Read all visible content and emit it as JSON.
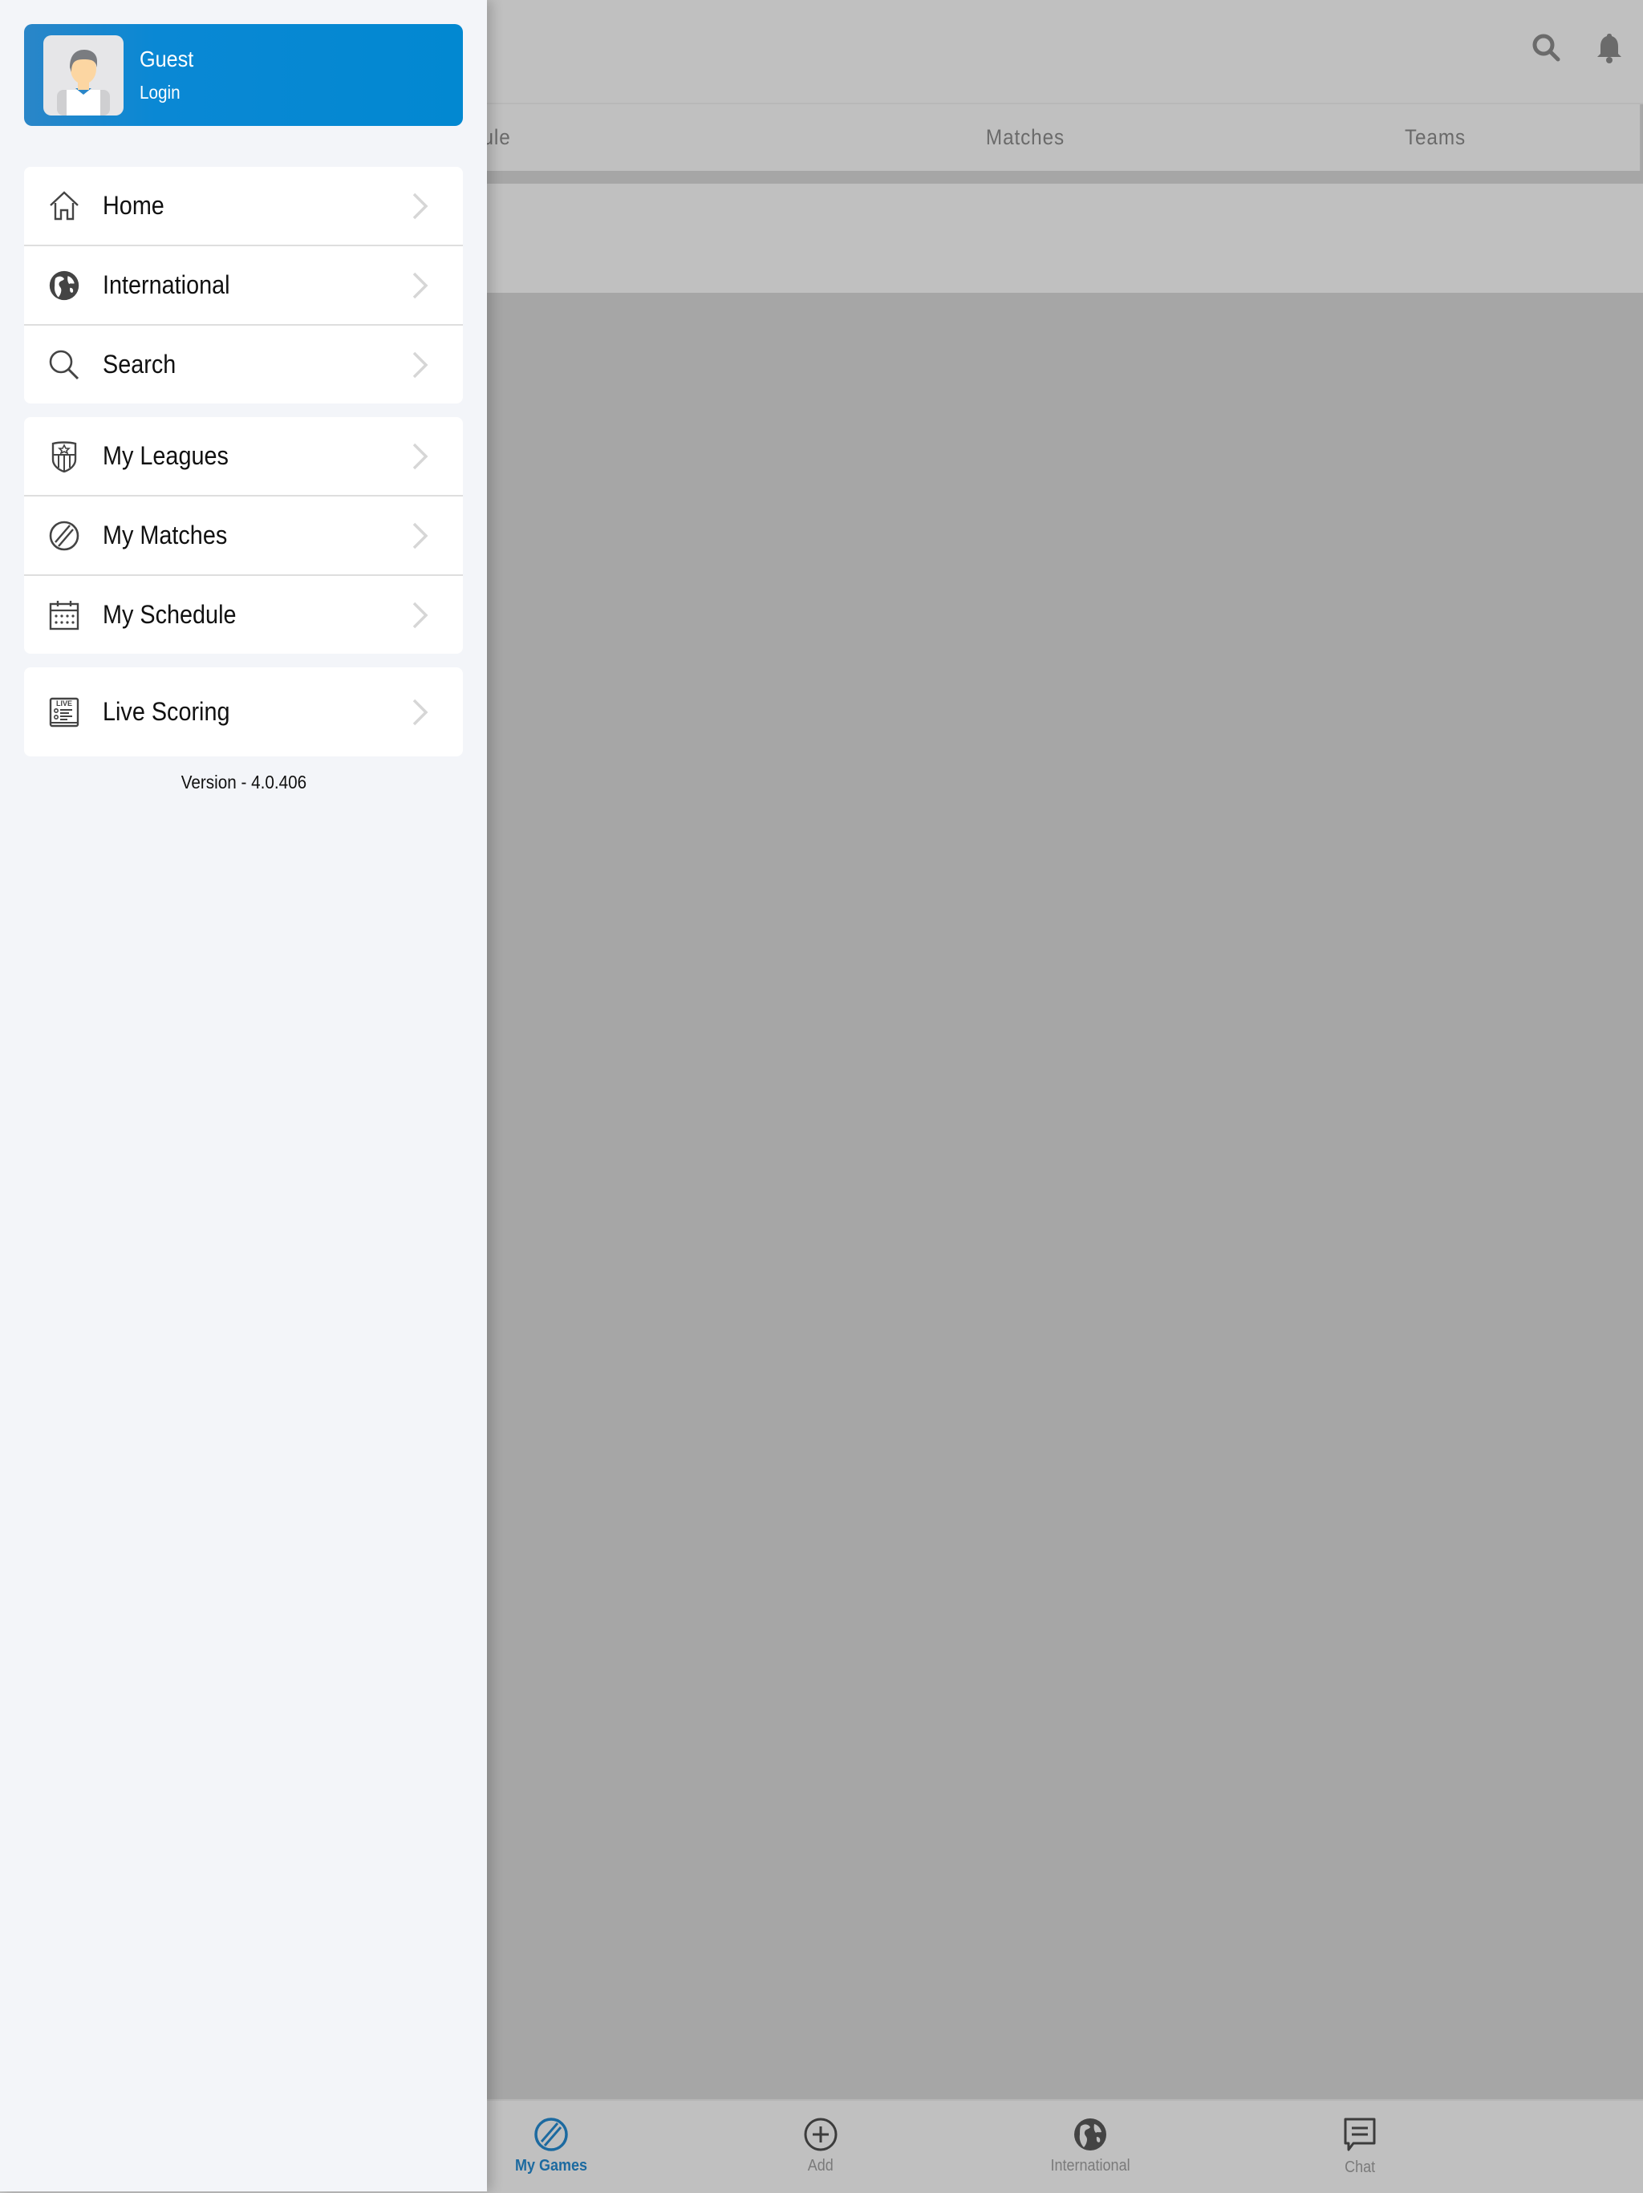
{
  "drawer": {
    "profile": {
      "name": "Guest",
      "action": "Login",
      "avatar_icon": "user-avatar-icon"
    },
    "groups": [
      [
        {
          "label": "Home",
          "icon": "home-icon"
        },
        {
          "label": "International",
          "icon": "globe-icon"
        },
        {
          "label": "Search",
          "icon": "search-icon"
        }
      ],
      [
        {
          "label": "My Leagues",
          "icon": "league-shield-icon"
        },
        {
          "label": "My Matches",
          "icon": "cricket-ball-icon"
        },
        {
          "label": "My Schedule",
          "icon": "calendar-icon"
        }
      ],
      [
        {
          "label": "Live Scoring",
          "icon": "live-scoring-icon"
        }
      ]
    ],
    "version": "Version - 4.0.406"
  },
  "app": {
    "header_icons": [
      "search-icon",
      "bell-icon"
    ],
    "tabs": [
      "Schedule",
      "Matches",
      "Teams"
    ],
    "bottom_nav": [
      {
        "label": "My Games",
        "icon": "cricket-ball-icon",
        "active": true
      },
      {
        "label": "Add",
        "icon": "add-circle-icon",
        "active": false
      },
      {
        "label": "International",
        "icon": "globe-icon",
        "active": false
      },
      {
        "label": "Chat",
        "icon": "chat-icon",
        "active": false
      }
    ]
  },
  "colors": {
    "accent": "#0288d1",
    "active_tab": "#1c6aa0",
    "drawer_bg": "#f3f5f9",
    "overlay": "#a6a6a6"
  }
}
